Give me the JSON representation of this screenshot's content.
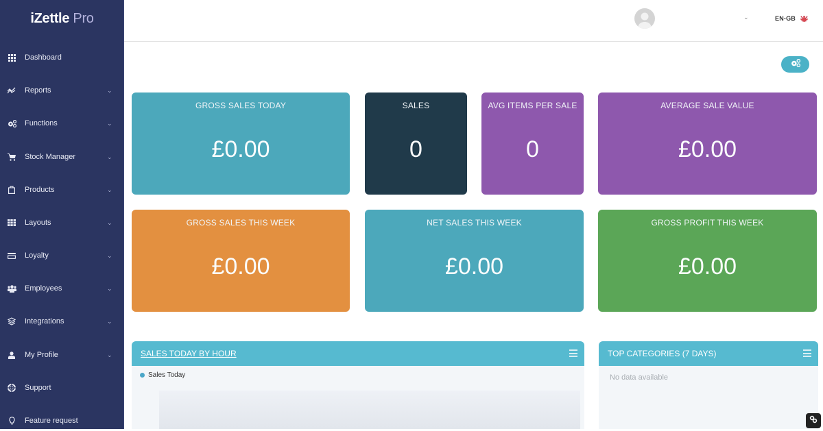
{
  "app": {
    "logo_main": "iZettle",
    "logo_suffix": "Pro"
  },
  "sidebar": {
    "items": [
      {
        "label": "Dashboard",
        "icon": "grid-icon",
        "has_submenu": false
      },
      {
        "label": "Reports",
        "icon": "chart-line-icon",
        "has_submenu": true
      },
      {
        "label": "Functions",
        "icon": "cogs-icon",
        "has_submenu": true
      },
      {
        "label": "Stock Manager",
        "icon": "cart-icon",
        "has_submenu": true
      },
      {
        "label": "Products",
        "icon": "shopping-bag-icon",
        "has_submenu": true
      },
      {
        "label": "Layouts",
        "icon": "grid-icon",
        "has_submenu": true
      },
      {
        "label": "Loyalty",
        "icon": "credit-card-icon",
        "has_submenu": true
      },
      {
        "label": "Employees",
        "icon": "users-icon",
        "has_submenu": true
      },
      {
        "label": "Integrations",
        "icon": "layers-icon",
        "has_submenu": true
      },
      {
        "label": "My Profile",
        "icon": "user-icon",
        "has_submenu": true
      },
      {
        "label": "Support",
        "icon": "life-ring-icon",
        "has_submenu": false
      },
      {
        "label": "Feature request",
        "icon": "lightbulb-icon",
        "has_submenu": false
      }
    ]
  },
  "header": {
    "language": "EN-GB",
    "user_menu_chevron": "⌄",
    "chevron": "⌄"
  },
  "cards": [
    {
      "title": "GROSS SALES TODAY",
      "value": "£0.00",
      "color": "#4ca8bb"
    },
    {
      "title": "SALES",
      "value": "0",
      "color": "#203a4a"
    },
    {
      "title": "AVG ITEMS PER SALE",
      "value": "0",
      "color": "#8e58ad"
    },
    {
      "title": "AVERAGE SALE VALUE",
      "value": "£0.00",
      "color": "#8e58ad"
    },
    {
      "title": "GROSS SALES THIS WEEK",
      "value": "£0.00",
      "color": "#e39040"
    },
    {
      "title": "NET SALES THIS WEEK",
      "value": "£0.00",
      "color": "#4ca8bb"
    },
    {
      "title": "GROSS PROFIT THIS WEEK",
      "value": "£0.00",
      "color": "#5ba657"
    }
  ],
  "panels": {
    "sales_by_hour": {
      "title": "SALES TODAY BY HOUR",
      "legend": "Sales Today",
      "legend_color": "#4aa6c8"
    },
    "top_categories": {
      "title": "TOP CATEGORIES (7 DAYS)",
      "empty_message": "No data available"
    }
  },
  "colors": {
    "sidebar_bg": "#2b3561",
    "accent": "#56bad0"
  }
}
